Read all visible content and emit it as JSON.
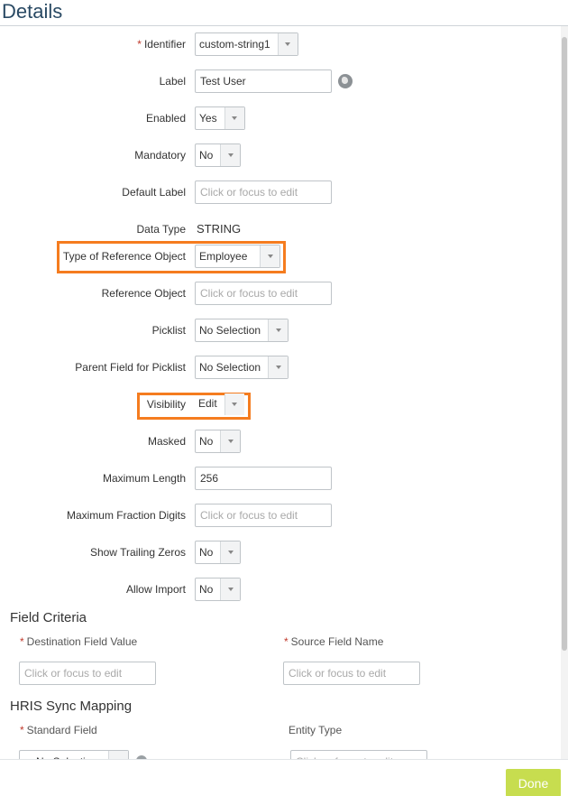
{
  "header": {
    "title": "Details"
  },
  "fields": {
    "identifier": {
      "label": "Identifier",
      "required_mark": "*",
      "value": "custom-string1"
    },
    "label": {
      "label": "Label",
      "value": "Test User",
      "icon": "globe-icon"
    },
    "enabled": {
      "label": "Enabled",
      "value": "Yes"
    },
    "mandatory": {
      "label": "Mandatory",
      "value": "No"
    },
    "default_label": {
      "label": "Default Label",
      "placeholder": "Click or focus to edit"
    },
    "data_type": {
      "label": "Data Type",
      "value": "STRING"
    },
    "type_of_reference_object": {
      "label": "Type of Reference Object",
      "value": "Employee",
      "highlighted": true
    },
    "reference_object": {
      "label": "Reference Object",
      "placeholder": "Click or focus to edit"
    },
    "picklist": {
      "label": "Picklist",
      "value": "No Selection"
    },
    "parent_field_for_picklist": {
      "label": "Parent Field for Picklist",
      "value": "No Selection"
    },
    "visibility": {
      "label": "Visibility",
      "value": "Edit",
      "highlighted": true
    },
    "masked": {
      "label": "Masked",
      "value": "No"
    },
    "maximum_length": {
      "label": "Maximum Length",
      "value": "256"
    },
    "maximum_fraction_digits": {
      "label": "Maximum Fraction Digits",
      "placeholder": "Click or focus to edit"
    },
    "show_trailing_zeros": {
      "label": "Show Trailing Zeros",
      "value": "No"
    },
    "allow_import": {
      "label": "Allow Import",
      "value": "No"
    }
  },
  "field_criteria": {
    "title": "Field Criteria",
    "destination_field_value": {
      "label": "Destination Field Value",
      "required_mark": "*",
      "placeholder": "Click or focus to edit"
    },
    "source_field_name": {
      "label": "Source Field Name",
      "required_mark": "*",
      "placeholder": "Click or focus to edit"
    }
  },
  "hris_sync_mapping": {
    "title": "HRIS Sync Mapping",
    "standard_field": {
      "label": "Standard Field",
      "required_mark": "*",
      "value": "No Selection"
    },
    "entity_type": {
      "label": "Entity Type",
      "placeholder": "Click or focus to edit"
    }
  },
  "footer": {
    "done_label": "Done"
  },
  "colors": {
    "highlight": "#f57c1f",
    "done_button": "#c7dd4f",
    "title": "#2a4a64",
    "required": "#c0392b"
  }
}
